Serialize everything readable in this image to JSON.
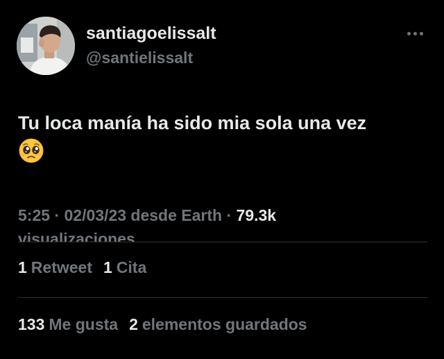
{
  "author": {
    "display_name": "santiagoelissalt",
    "handle": "@santielissalt"
  },
  "menu": {
    "icon": "more-horizontal-icon"
  },
  "tweet": {
    "text": "Tu loca manía ha sido mia sola una vez",
    "emoji_icon": "pleading-face-emoji"
  },
  "meta": {
    "time": "5:25",
    "separator": " · ",
    "date": "02/03/23",
    "source": " desde Earth",
    "views_count": "79.3k",
    "views_label": "visualizaciones"
  },
  "stats_row1": {
    "retweets_count": "1",
    "retweets_label": "Retweet",
    "quotes_count": "1",
    "quotes_label": "Cita"
  },
  "stats_row2": {
    "likes_count": "133",
    "likes_label": "Me gusta",
    "bookmarks_count": "2",
    "bookmarks_label": "elementos guardados"
  }
}
